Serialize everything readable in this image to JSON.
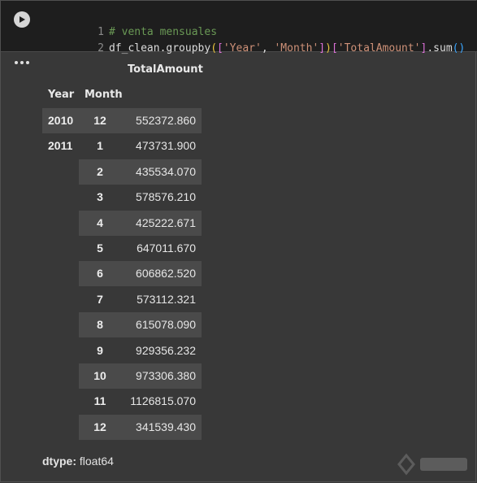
{
  "code": {
    "line1": {
      "num": "1",
      "comment": "# venta mensuales"
    },
    "line2": {
      "num": "2",
      "p1": "df_clean.groupby",
      "p2": "(",
      "p3": "[",
      "p4": "'Year'",
      "p5": ", ",
      "p6": "'Month'",
      "p7": "]",
      "p8": ")",
      "p9": "[",
      "p10": "'TotalAmount'",
      "p11": "]",
      "p12": ".sum",
      "p13": "()"
    }
  },
  "output": {
    "column_header": "TotalAmount",
    "index_headers": [
      "Year",
      "Month"
    ],
    "rows": [
      {
        "year": "2010",
        "month": "12",
        "value": "552372.860"
      },
      {
        "year": "2011",
        "month": "1",
        "value": "473731.900"
      },
      {
        "year": "",
        "month": "2",
        "value": "435534.070"
      },
      {
        "year": "",
        "month": "3",
        "value": "578576.210"
      },
      {
        "year": "",
        "month": "4",
        "value": "425222.671"
      },
      {
        "year": "",
        "month": "5",
        "value": "647011.670"
      },
      {
        "year": "",
        "month": "6",
        "value": "606862.520"
      },
      {
        "year": "",
        "month": "7",
        "value": "573112.321"
      },
      {
        "year": "",
        "month": "8",
        "value": "615078.090"
      },
      {
        "year": "",
        "month": "9",
        "value": "929356.232"
      },
      {
        "year": "",
        "month": "10",
        "value": "973306.380"
      },
      {
        "year": "",
        "month": "11",
        "value": "1126815.070"
      },
      {
        "year": "",
        "month": "12",
        "value": "341539.430"
      }
    ],
    "dtype_label": "dtype:",
    "dtype_value": " float64"
  },
  "icons": {
    "run": "play-icon",
    "output_menu": "more-horiz-icon"
  },
  "colors": {
    "background": "#383838",
    "code_background": "#1e1e1e",
    "row_shade": "#4a4a4a"
  }
}
